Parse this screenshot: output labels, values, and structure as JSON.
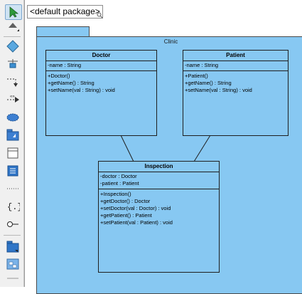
{
  "breadcrumb": "<default package>",
  "toolbar": {
    "tools": [
      "select-tool",
      "class-tool",
      "generalization-tool",
      "dependency-tool",
      "realization-tool",
      "note-tool",
      "package-tool",
      "frame-tool",
      "document-tool",
      "separator-tool",
      "template-tool",
      "interface-tool",
      "model-tool",
      "subsystem-tool"
    ]
  },
  "package": {
    "name": "Clinic"
  },
  "classes": [
    {
      "name": "Doctor",
      "attributes": [
        "-name : String"
      ],
      "operations": [
        "+Doctor()",
        "+getName() : String",
        "+setName(val : String) : void"
      ]
    },
    {
      "name": "Patient",
      "attributes": [
        "-name : String"
      ],
      "operations": [
        "+Patient()",
        "+getName() : String",
        "+setName(val : String) : void"
      ]
    },
    {
      "name": "Inspection",
      "attributes": [
        "-doctor : Doctor",
        "-patient : Patient"
      ],
      "operations": [
        "+Inspection()",
        "+getDoctor() : Doctor",
        "+setDoctor(val : Doctor) : void",
        "+getPatient() : Patient",
        "+setPatient(val : Patient) : void"
      ]
    }
  ],
  "colors": {
    "class_fill": "#87c8f2",
    "package_fill": "#87c8f2",
    "outline": "#1f1f1f"
  }
}
